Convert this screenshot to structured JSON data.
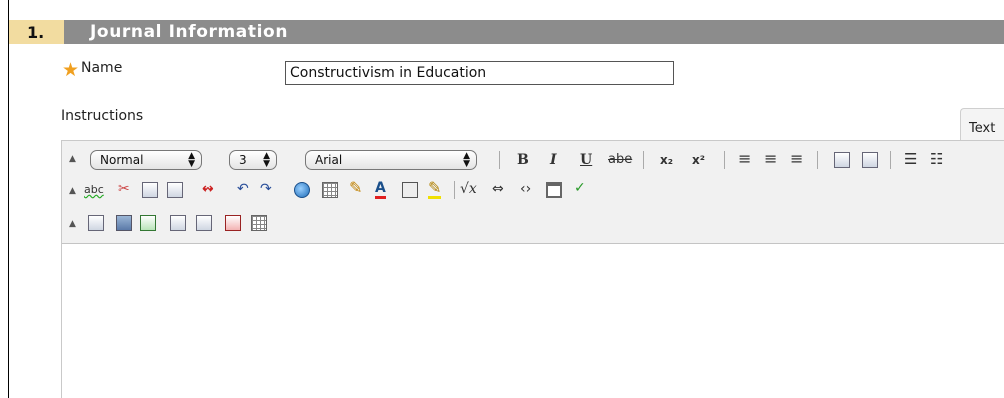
{
  "section": {
    "number": "1.",
    "title": "Journal Information"
  },
  "name_field": {
    "label": "Name",
    "value": "Constructivism in Education"
  },
  "instructions_label": "Instructions",
  "text_tab_label": "Text",
  "toolbar": {
    "format_select": "Normal",
    "size_select": "3",
    "font_select": "Arial",
    "bold": "B",
    "italic": "I",
    "underline": "U",
    "strike": "abe",
    "subscript": "x₂",
    "superscript": "x²",
    "spellcheck": "abc",
    "text_color": "A",
    "math": "√x",
    "undo": "↶",
    "redo": "↷",
    "link_break": "↭",
    "embed_code": "<›",
    "html_code": "‹›",
    "check": "✓"
  },
  "colors": {
    "section_bar": "#8c8c8c",
    "section_number_bg": "#f2dca0",
    "required_star": "#f0a020",
    "toolbar_bg": "#f1f1f1"
  },
  "editor_content": ""
}
